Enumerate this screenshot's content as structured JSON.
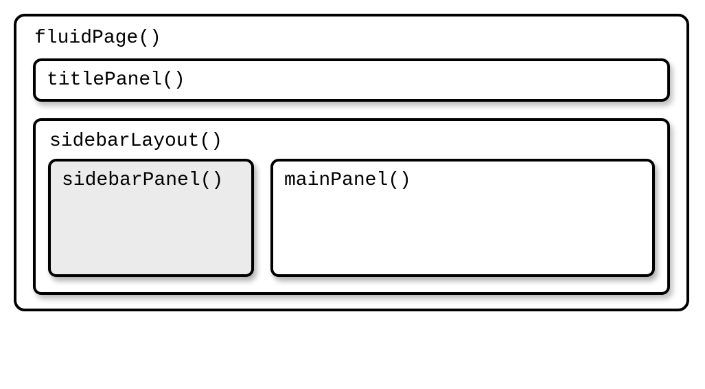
{
  "fluidPage": {
    "label": "fluidPage()"
  },
  "titlePanel": {
    "label": "titlePanel()"
  },
  "sidebarLayout": {
    "label": "sidebarLayout()"
  },
  "sidebarPanel": {
    "label": "sidebarPanel()"
  },
  "mainPanel": {
    "label": "mainPanel()"
  }
}
